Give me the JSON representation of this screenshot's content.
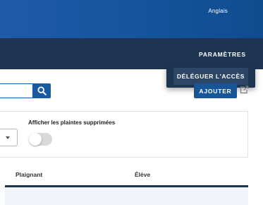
{
  "header": {
    "language": "Anglais"
  },
  "nav": {
    "settings_label": "PARAMÈTRES",
    "dropdown": {
      "items": [
        {
          "label": "DÉLÉGUER L'ACCÈS"
        }
      ]
    }
  },
  "toolbar": {
    "search": {
      "value": "",
      "placeholder": ""
    },
    "search_icon": "search-icon",
    "add_label": "AJOUTER",
    "export_icon": "export-icon"
  },
  "filters": {
    "show_deleted_label": "Afficher les plaintes supprimées",
    "show_deleted_on": false
  },
  "table": {
    "columns": [
      "Plaignant",
      "Élève"
    ]
  },
  "colors": {
    "header_blue": "#1f5aa8",
    "nav_navy": "#1e3552",
    "button_blue": "#175596"
  }
}
